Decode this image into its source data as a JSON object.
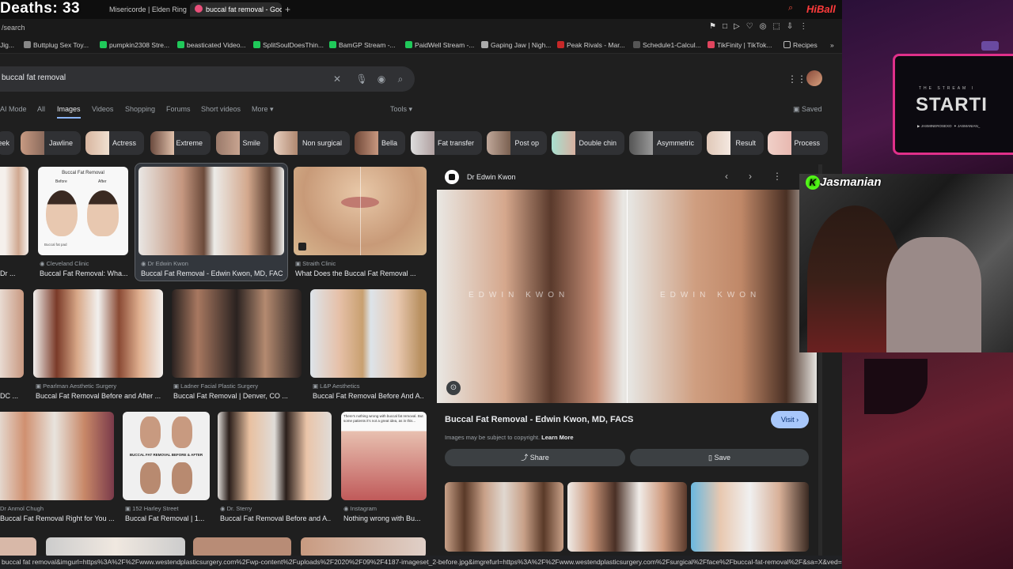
{
  "stream": {
    "deaths": "Deaths: 33",
    "handle": "HiBall",
    "cam_name": "Jasmanian",
    "starting_text": "STARTI",
    "starting_small": "THE STREAM I",
    "socials": [
      "JASMINEROSEXO",
      "JASMANIAN_"
    ]
  },
  "tabs": [
    {
      "label": "Misericorde | Elden Ring"
    },
    {
      "label": "buccal fat removal - Goog"
    }
  ],
  "url": "/search",
  "bookmarks": [
    {
      "label": "Jig..."
    },
    {
      "label": "Buttplug Sex Toy..."
    },
    {
      "label": "pumpkin2308 Stre..."
    },
    {
      "label": "beasticated Video..."
    },
    {
      "label": "SplitSoulDoesThin..."
    },
    {
      "label": "BamGP Stream -..."
    },
    {
      "label": "PaidWell Stream -..."
    },
    {
      "label": "Gaping Jaw | Nigh..."
    },
    {
      "label": "Peak Rivals - Mar..."
    },
    {
      "label": "Schedule1-Calcul..."
    },
    {
      "label": "TikFinity | TikTok..."
    },
    {
      "label": "Recipes"
    }
  ],
  "search": {
    "query": "buccal fat removal"
  },
  "nav": {
    "items": [
      "AI Mode",
      "All",
      "Images",
      "Videos",
      "Shopping",
      "Forums",
      "Short videos",
      "More"
    ],
    "tools": "Tools",
    "saved": "Saved"
  },
  "chips": [
    "eek",
    "Jawline",
    "Actress",
    "Extreme",
    "Smile",
    "Non surgical",
    "Bella",
    "Fat transfer",
    "Post op",
    "Double chin",
    "Asymmetric",
    "Result",
    "Process"
  ],
  "results": [
    {
      "source": "",
      "title": "Dr ..."
    },
    {
      "source": "Cleveland Clinic",
      "title": "Buccal Fat Removal: Wha..."
    },
    {
      "source": "Dr Edwin Kwon",
      "title": "Buccal Fat Removal - Edwin Kwon, MD, FACS"
    },
    {
      "source": "Straith Clinic",
      "title": "What Does the Buccal Fat Removal ..."
    },
    {
      "source": "",
      "title": "DC ..."
    },
    {
      "source": "Pearlman Aesthetic Surgery",
      "title": "Buccal Fat Removal Before and After ..."
    },
    {
      "source": "Ladner Facial Plastic Surgery",
      "title": "Buccal Fat Removal | Denver, CO ..."
    },
    {
      "source": "L&P Aesthetics",
      "title": "Buccal Fat Removal Before And A..."
    },
    {
      "source": "Dr Anmol Chugh",
      "title": "Buccal Fat Removal Right for You ..."
    },
    {
      "source": "152 Harley Street",
      "title": "Buccal Fat Removal | 1..."
    },
    {
      "source": "Dr. Sterry",
      "title": "Buccal Fat Removal Before and A..."
    },
    {
      "source": "Instagram",
      "title": "Nothing wrong with Bu..."
    }
  ],
  "thumb_text": {
    "cc_title": "Buccal Fat Removal",
    "before": "Before",
    "after": "After",
    "buccal_pad": "Buccal fat pad",
    "harley": "BUCCAL FAT REMOVAL BEFORE & AFTER",
    "insta": "There's nothing wrong with buccal fat removal. But some patients it's not a great idea, as in this..."
  },
  "panel": {
    "source": "Dr Edwin Kwon",
    "watermark": "EDWIN KWON",
    "title": "Buccal Fat Removal - Edwin Kwon, MD, FACS",
    "visit": "Visit",
    "copyright": "Images may be subject to copyright.",
    "learn_more": "Learn More",
    "share": "Share",
    "save": "Save"
  },
  "status_url": "buccal fat removal&imgurl=https%3A%2F%2Fwww.westendplasticsurgery.com%2Fwp-content%2Fuploads%2F2020%2F09%2F4187-imageset_2-before.jpg&imgrefurl=https%3A%2F%2Fwww.westendplasticsurgery.com%2Fsurgical%2Fface%2Fbuccal-fat-removal%2F&sa=X&ved=2ahUKEwi..."
}
